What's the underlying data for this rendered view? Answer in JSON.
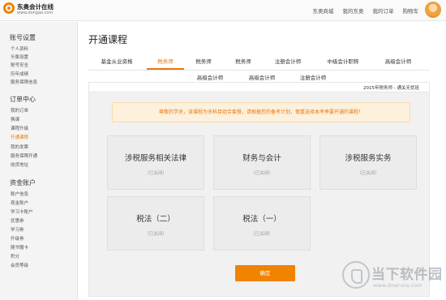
{
  "header": {
    "logo_name": "东奥会计在线",
    "logo_url": "www.dongao.com",
    "links": [
      "东奥商城",
      "我的东奥",
      "我的订单",
      "购物车"
    ]
  },
  "sidebar": {
    "groups": [
      {
        "title": "账号设置",
        "items": [
          "个人资料",
          "头像设置",
          "账号安全",
          "历年成绩",
          "服务保障信息"
        ]
      },
      {
        "title": "订单中心",
        "items": [
          "我的订单",
          "换课",
          "课程升级",
          "开通课程",
          "我的发票",
          "服务保障开通",
          "收货地址"
        ]
      },
      {
        "title": "资金账户",
        "items": [
          "账户信息",
          "现金账户",
          "学习卡账户",
          "优惠券",
          "学习券",
          "升级券",
          "随书赠卡",
          "积分",
          "会员等级"
        ]
      }
    ],
    "active_item": "开通课程"
  },
  "main": {
    "title": "开通课程",
    "tabs_row1": [
      "基金从业资格",
      "税务师",
      "税务师",
      "税务师",
      "注册会计师",
      "中级会计职称",
      "高级会计师"
    ],
    "tabs_row2": [
      "高级会计师",
      "高级会计师",
      "注册会计师"
    ],
    "active_tab_index": 1,
    "plan_label": "2015年税务师 - 通关无忧班",
    "notice": "尊敬的学员，该课程为多科目组合套餐，请根据您的备考计划，慎重选择本考季要开通的课程！",
    "courses": [
      {
        "title": "涉税服务相关法律",
        "status": "（已关闭）"
      },
      {
        "title": "财务与会计",
        "status": "（已关闭）"
      },
      {
        "title": "涉税服务实务",
        "status": "（已关闭）"
      },
      {
        "title": "税法（二）",
        "status": "（已关闭）"
      },
      {
        "title": "税法（一）",
        "status": "（已关闭）"
      }
    ],
    "confirm_label": "确定"
  },
  "watermark": {
    "text": "当下软件园",
    "url": "www.downxia.com"
  },
  "colors": {
    "accent": "#f08300",
    "active_text": "#e8790e",
    "notice_bg": "#fdf0dc"
  }
}
